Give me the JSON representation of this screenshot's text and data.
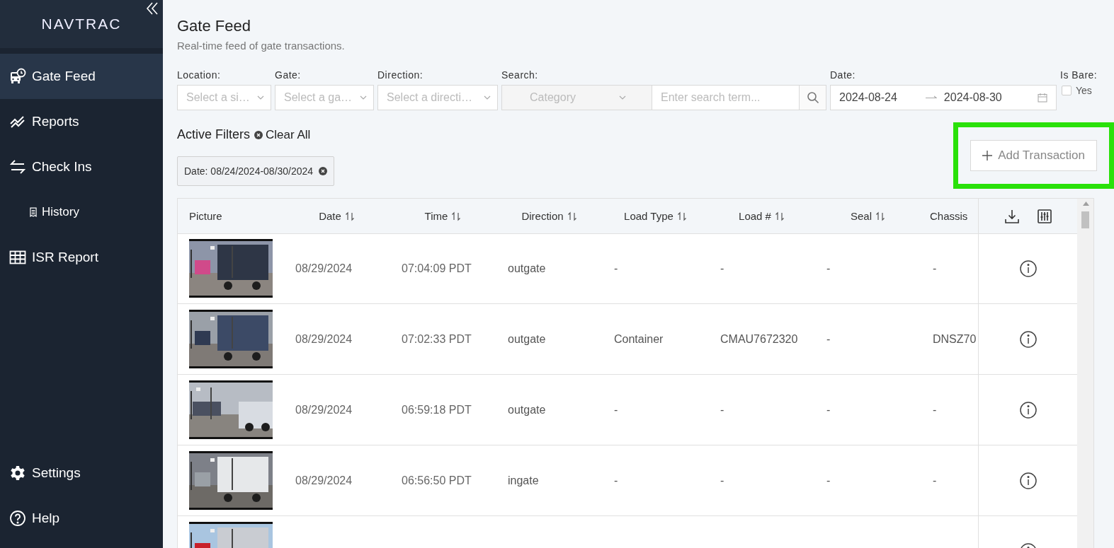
{
  "sidebar": {
    "logo": "NAVTRAC",
    "items": [
      {
        "kind": "gate",
        "label": "Gate Feed",
        "selected": true
      },
      {
        "kind": "reports",
        "label": "Reports",
        "selected": false
      },
      {
        "kind": "checkins",
        "label": "Check Ins",
        "selected": false,
        "children": [
          {
            "kind": "history",
            "label": "History",
            "selected": false
          }
        ]
      },
      {
        "kind": "table",
        "label": "ISR Report",
        "selected": false
      }
    ],
    "footer_items": [
      {
        "kind": "settings",
        "label": "Settings",
        "selected": false
      },
      {
        "kind": "help",
        "label": "Help",
        "selected": false
      }
    ]
  },
  "page": {
    "title": "Gate Feed",
    "subtitle": "Real-time feed of gate transactions."
  },
  "filters": {
    "location": {
      "label": "Location:",
      "placeholder": "Select a si…"
    },
    "gate": {
      "label": "Gate:",
      "placeholder": "Select a ga…"
    },
    "direction": {
      "label": "Direction:",
      "placeholder": "Select a directi…"
    },
    "search": {
      "label": "Search:",
      "category_placeholder": "Category",
      "category_disabled": true,
      "placeholder": "Enter search term..."
    },
    "date": {
      "label": "Date:",
      "start": "2024-08-24",
      "end": "2024-08-30"
    },
    "is_bare": {
      "label": "Is Bare:",
      "option": "Yes",
      "checked": false
    }
  },
  "active_filters": {
    "title": "Active Filters",
    "clear": "Clear All",
    "chips": [
      "Date: 08/24/2024-08/30/2024"
    ]
  },
  "add_button": {
    "label": "Add Transaction",
    "highlighted": true
  },
  "table": {
    "columns": [
      {
        "label": "Picture",
        "sortable": false
      },
      {
        "label": "Date",
        "sortable": true
      },
      {
        "label": "Time",
        "sortable": true
      },
      {
        "label": "Direction",
        "sortable": true
      },
      {
        "label": "Load Type",
        "sortable": true
      },
      {
        "label": "Load #",
        "sortable": true
      },
      {
        "label": "Seal",
        "sortable": true
      },
      {
        "label": "Chassis",
        "sortable": false
      }
    ],
    "rows": [
      {
        "picture": {
          "kind": "picture"
        },
        "cells": [
          "08/29/2024",
          "07:04:09 PDT",
          "outgate",
          "-",
          "-",
          "-",
          "-"
        ]
      },
      {
        "picture": {
          "kind": "picture"
        },
        "cells": [
          "08/29/2024",
          "07:02:33 PDT",
          "outgate",
          "Container",
          "CMAU7672320",
          "-",
          "DNSZ70"
        ]
      },
      {
        "picture": {
          "kind": "picture"
        },
        "cells": [
          "08/29/2024",
          "06:59:18 PDT",
          "outgate",
          "-",
          "-",
          "-",
          "-"
        ]
      },
      {
        "picture": {
          "kind": "picture"
        },
        "cells": [
          "08/29/2024",
          "06:56:50 PDT",
          "ingate",
          "-",
          "-",
          "-",
          "-"
        ]
      },
      {
        "picture": {
          "kind": "picture"
        }
      }
    ]
  }
}
